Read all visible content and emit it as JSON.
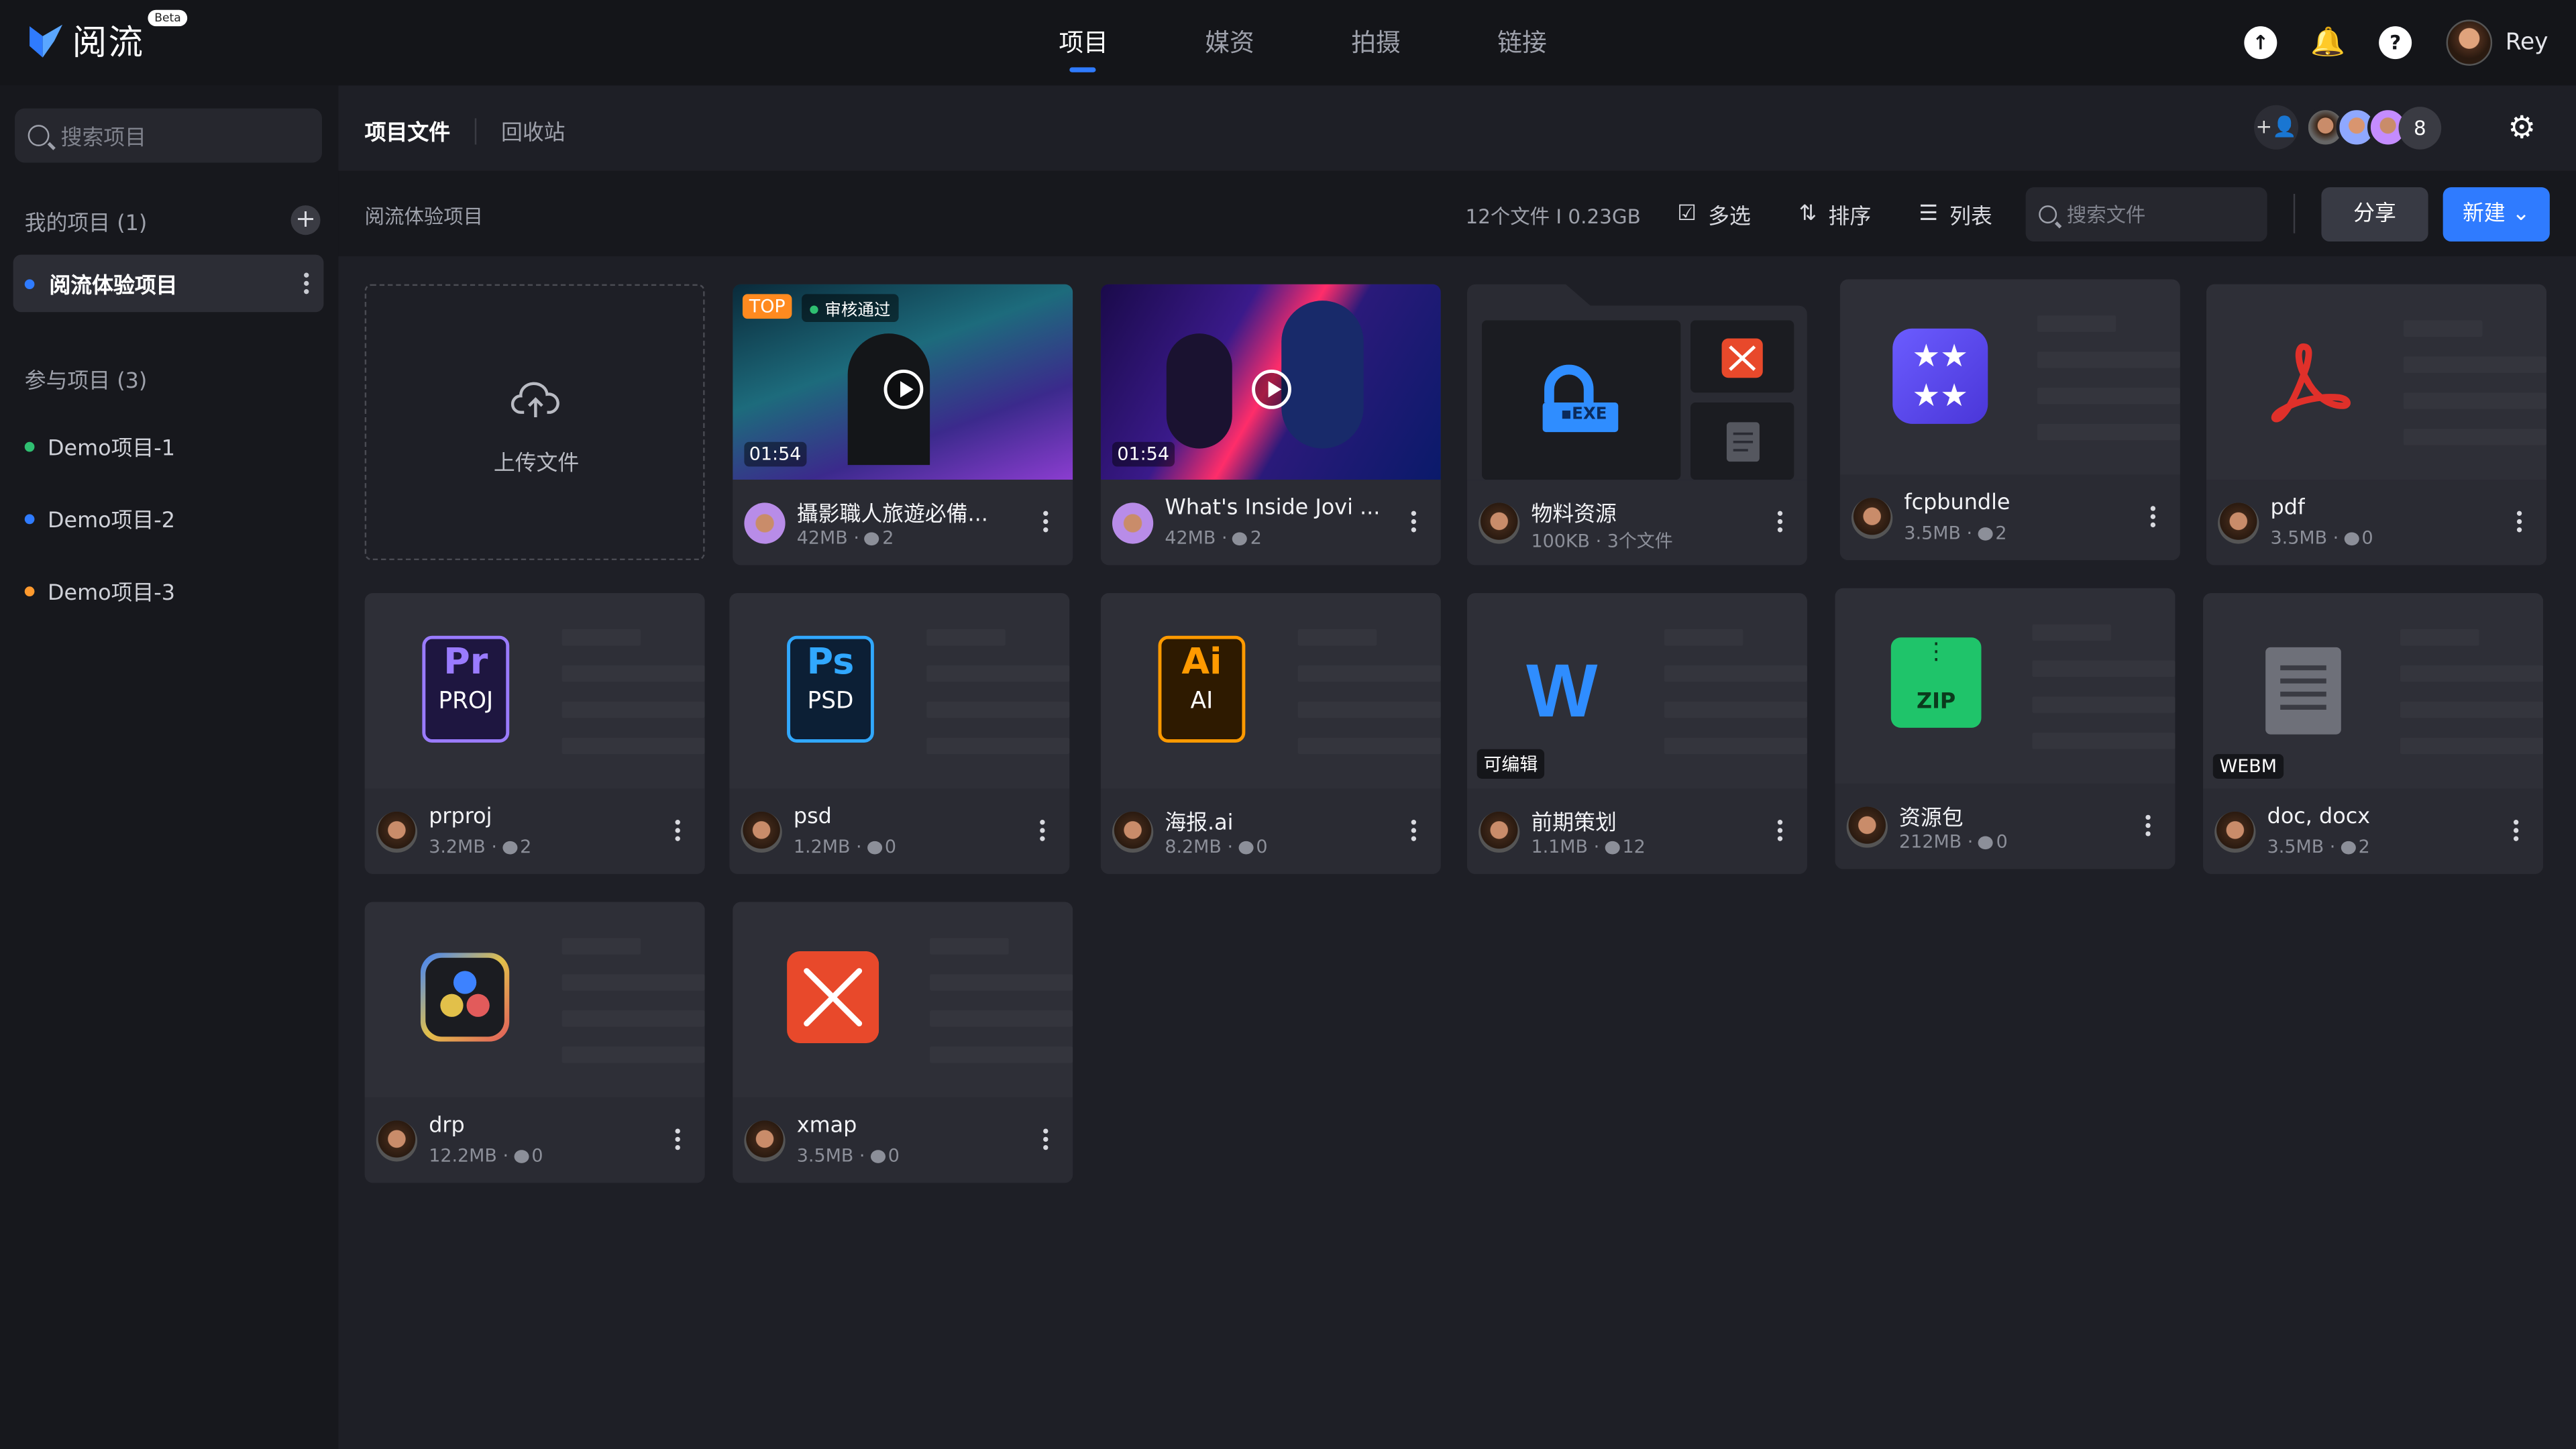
{
  "app": {
    "name": "阅流",
    "badge": "Beta",
    "user": "Rey"
  },
  "nav": [
    "项目",
    "媒资",
    "拍摄",
    "链接"
  ],
  "sidebar": {
    "search_placeholder": "搜索项目",
    "my_projects": "我的项目 (1)",
    "active_project": "阅流体验项目",
    "joined": "参与项目 (3)",
    "demos": [
      {
        "label": "Demo项目-1",
        "color": "#2fbf71"
      },
      {
        "label": "Demo项目-2",
        "color": "#2f7bff"
      },
      {
        "label": "Demo项目-3",
        "color": "#ff9a2e"
      }
    ]
  },
  "main": {
    "tab_files": "项目文件",
    "tab_trash": "回收站",
    "collab_count": "8",
    "breadcrumb": "阅流体验项目",
    "stats": "12个文件  I  0.23GB",
    "tools": {
      "multi": "多选",
      "sort": "排序",
      "list": "列表"
    },
    "search_placeholder": "搜索文件",
    "share": "分享",
    "new": "新建",
    "upload": "上传文件"
  },
  "files": [
    {
      "name": "攝影職人旅遊必備...",
      "meta": "42MB",
      "comments": "2",
      "top": "TOP",
      "status": "审核通过",
      "duration": "01:54"
    },
    {
      "name": "What's Inside Jovi ...",
      "meta": "42MB",
      "comments": "2",
      "duration": "01:54"
    },
    {
      "name": "物料资源",
      "meta": "100KB · 3个文件"
    },
    {
      "name": "fcpbundle",
      "meta": "3.5MB",
      "comments": "2"
    },
    {
      "name": "pdf",
      "meta": "3.5MB",
      "comments": "0"
    },
    {
      "name": "prproj",
      "meta": "3.2MB",
      "comments": "2",
      "icon_top": "Pr",
      "icon_bottom": "PROJ"
    },
    {
      "name": "psd",
      "meta": "1.2MB",
      "comments": "0",
      "icon_top": "Ps",
      "icon_bottom": "PSD"
    },
    {
      "name": "海报.ai",
      "meta": "8.2MB",
      "comments": "0",
      "icon_top": "Ai",
      "icon_bottom": "AI"
    },
    {
      "name": "前期策划",
      "meta": "1.1MB",
      "comments": "12",
      "badge": "可编辑"
    },
    {
      "name": "资源包",
      "meta": "212MB",
      "comments": "0",
      "zip": "ZIP"
    },
    {
      "name": "doc, docx",
      "meta": "3.5MB",
      "comments": "2",
      "badge": "WEBM"
    },
    {
      "name": "drp",
      "meta": "12.2MB",
      "comments": "0"
    },
    {
      "name": "xmap",
      "meta": "3.5MB",
      "comments": "0"
    }
  ],
  "colors": {
    "accent": "#2f7bff",
    "bg": "#1e1f26",
    "card": "#2a2b33"
  }
}
